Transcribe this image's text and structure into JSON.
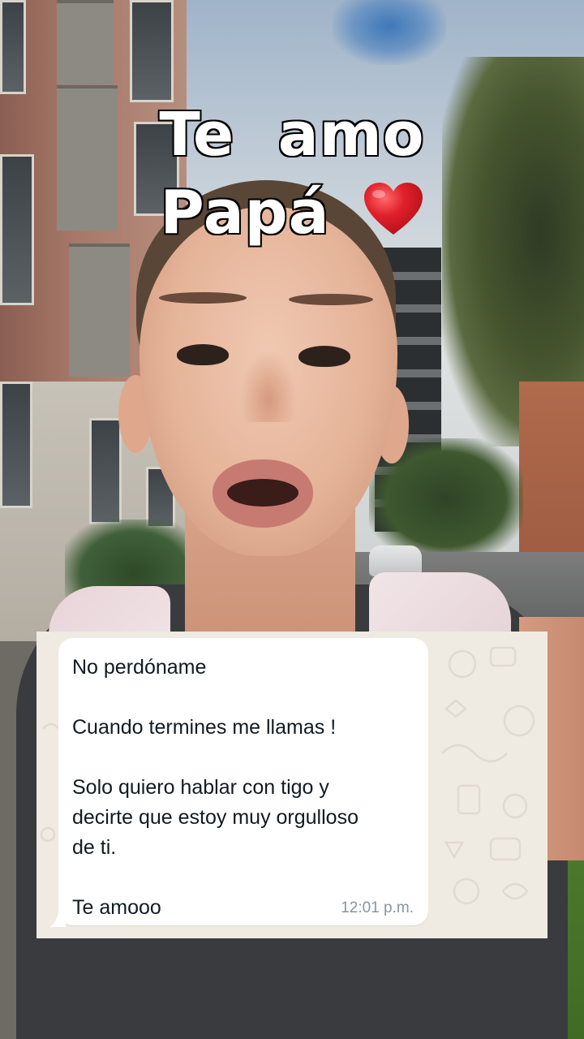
{
  "caption": {
    "line1": "Te  amo",
    "line2": "Papá"
  },
  "icons": {
    "heart": "red-heart-emoji-icon"
  },
  "colors": {
    "caption_text": "#ffffff",
    "caption_outline": "#000000",
    "heart": "#e0202a",
    "chat_background": "#efeae2",
    "bubble_background": "#ffffff",
    "message_text": "#111b21",
    "timestamp": "#8696a0"
  },
  "message": {
    "lines": [
      "No perdóname",
      "",
      "Cuando termines me llamas !",
      "",
      "Solo quiero hablar con tigo y",
      "decirte que estoy muy orgulloso",
      "de ti.",
      "",
      "Te amooo"
    ],
    "time": "12:01 p.m."
  }
}
